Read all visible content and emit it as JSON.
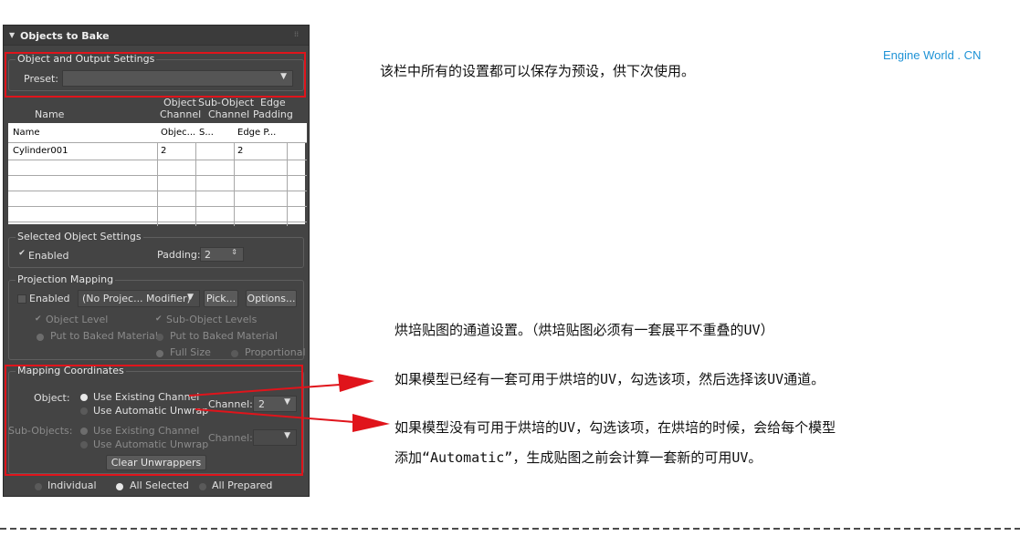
{
  "rollout": {
    "title": "Objects to Bake"
  },
  "object_output": {
    "group_label": "Object and Output Settings",
    "preset_label": "Preset:",
    "preset_value": ""
  },
  "channel_headers": {
    "name": "Name",
    "object_channel_1": "Object",
    "object_channel_2": "Channel",
    "subobject_channel_1": "Sub-Object",
    "subobject_channel_2": "Channel",
    "edge_padding_1": "Edge",
    "edge_padding_2": "Padding"
  },
  "table": {
    "columns": [
      "Name",
      "Objec...",
      "S...",
      "Edge P..."
    ],
    "rows": [
      [
        "Cylinder001",
        "2",
        "",
        "2"
      ]
    ]
  },
  "selected_object": {
    "group_label": "Selected Object Settings",
    "enabled_label": "Enabled",
    "padding_label": "Padding:",
    "padding_value": "2"
  },
  "projection": {
    "group_label": "Projection Mapping",
    "enabled_label": "Enabled",
    "modifier_value": "(No Projec... Modifier)",
    "pick_label": "Pick...",
    "options_label": "Options...",
    "object_level": "Object Level",
    "subobject_levels": "Sub-Object Levels",
    "put_baked_1": "Put to Baked Material",
    "put_baked_2": "Put to Baked Material",
    "full_size": "Full Size",
    "proportional": "Proportional"
  },
  "mapping": {
    "group_label": "Mapping Coordinates",
    "object_label": "Object:",
    "use_existing": "Use Existing Channel",
    "use_auto": "Use Automatic Unwrap",
    "channel_label": "Channel:",
    "channel_value": "2",
    "subobjects_label": "Sub-Objects:",
    "sub_use_existing": "Use Existing Channel",
    "sub_use_auto": "Use Automatic Unwrap",
    "sub_channel_label": "Channel:",
    "clear_label": "Clear Unwrappers"
  },
  "bottom_radios": {
    "individual": "Individual",
    "all_selected": "All Selected",
    "all_prepared": "All Prepared"
  },
  "annotations": {
    "note1": "该栏中所有的设置都可以保存为预设，供下次使用。",
    "brand": "Engine World . CN",
    "note2": "烘培贴图的通道设置。（烘培贴图必须有一套展平不重叠的UV）",
    "note3": "如果模型已经有一套可用于烘培的UV，勾选该项，然后选择该UV通道。",
    "note4a": "如果模型没有可用于烘培的UV，勾选该项，在烘培的时候，会给每个模型",
    "note4b": "添加“Automatic”，生成贴图之前会计算一套新的可用UV。"
  },
  "colors": {
    "accent_red": "#e0141b",
    "brand_blue": "#1f93d6",
    "panel_bg": "#444444"
  }
}
